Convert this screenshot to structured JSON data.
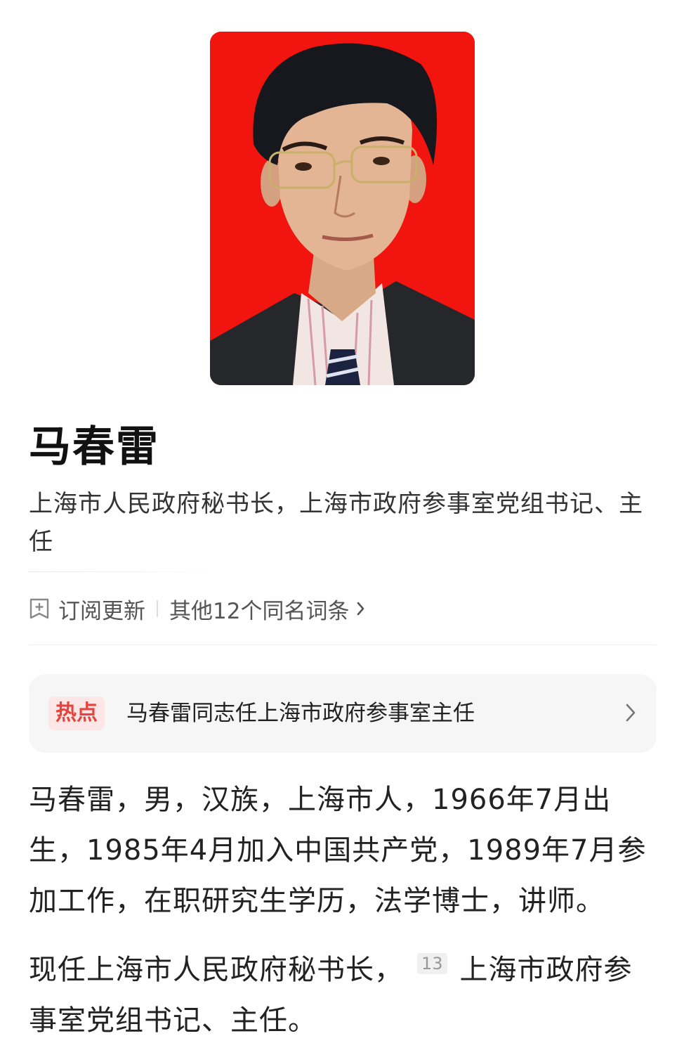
{
  "person": {
    "name": "马春雷",
    "title": "上海市人民政府秘书长，上海市政府参事室党组书记、主任"
  },
  "actions": {
    "subscribe_label": "订阅更新",
    "same_name_label": "其他12个同名词条"
  },
  "hot": {
    "badge": "热点",
    "headline": "马春雷同志任上海市政府参事室主任"
  },
  "bio": {
    "paragraph1": "马春雷，男，汉族，上海市人，1966年7月出生，1985年4月加入中国共产党，1989年7月参加工作，在职研究生学历，法学博士，讲师。",
    "paragraph2_part1": "现任上海市人民政府秘书长，",
    "citation": "13",
    "paragraph2_part2": "上海市政府参事室党组书记、主任。"
  },
  "colors": {
    "portrait_background": "#f2140f",
    "hot_badge_text": "#e5433e",
    "hot_badge_bg": "#fde7e6",
    "card_bg": "#f6f6f7"
  },
  "icons": {
    "subscribe": "subscribe-icon",
    "same_name_arrow": "chevron-right-icon",
    "hot_arrow": "chevron-right-icon"
  }
}
